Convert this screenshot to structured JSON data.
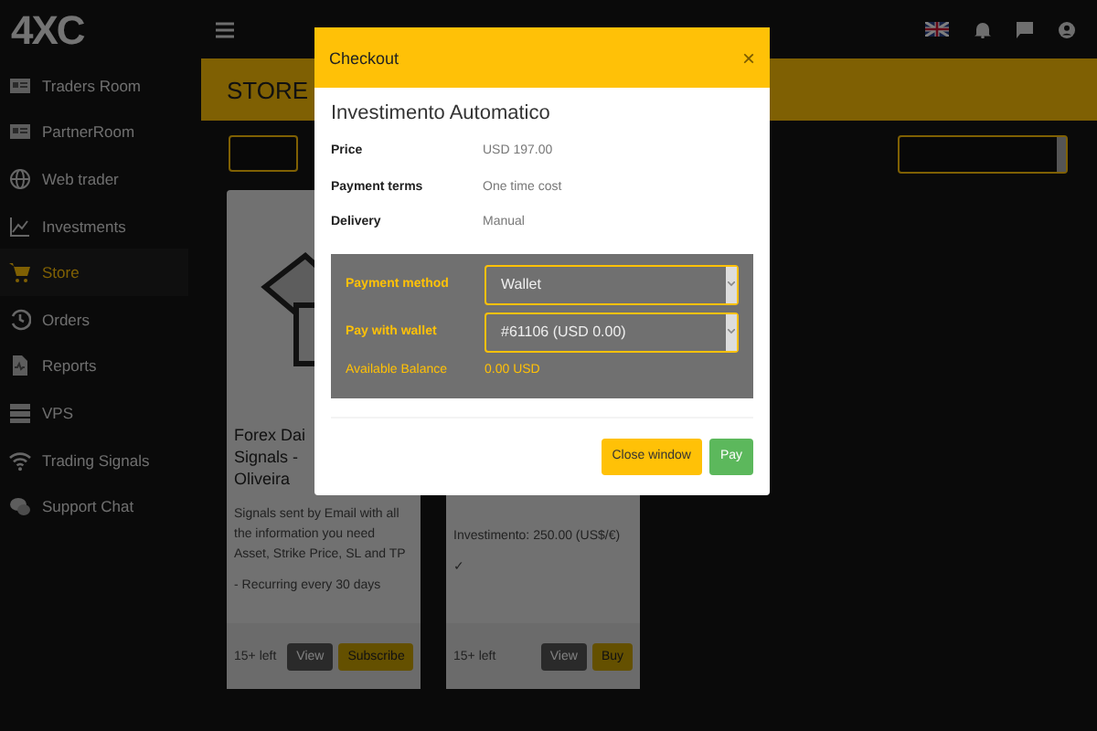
{
  "brand": "4XC",
  "sidebar": {
    "items": [
      {
        "label": "Traders Room",
        "selected": false
      },
      {
        "label": "PartnerRoom",
        "selected": false
      },
      {
        "label": "Web trader",
        "selected": false
      },
      {
        "label": "Investments",
        "selected": false
      },
      {
        "label": "Store",
        "selected": true
      },
      {
        "label": "Orders",
        "selected": false
      },
      {
        "label": "Reports",
        "selected": false
      },
      {
        "label": "VPS",
        "selected": false
      },
      {
        "label": "Trading Signals",
        "selected": false
      },
      {
        "label": "Support Chat",
        "selected": false
      }
    ]
  },
  "page": {
    "title": "STORE"
  },
  "cards": [
    {
      "kind": "image",
      "title_lines": [
        "Forex Dai",
        "Signals -",
        "Oliveira"
      ],
      "description": "Signals sent by Email with all the information you need Asset, Strike Price, SL and TP",
      "note": "- Recurring every 30 days",
      "stock": "15+ left",
      "buttons": [
        "View",
        "Subscribe"
      ]
    },
    {
      "kind": "covered",
      "description": "Investimento: 250.00 (US$/€)",
      "note": "✓",
      "stock": "15+ left",
      "buttons": [
        "View",
        "Buy"
      ]
    }
  ],
  "modal": {
    "title": "Checkout",
    "close": "×",
    "product": "Investimento Automatico",
    "details": [
      {
        "label": "Price",
        "value": "USD 197.00"
      },
      {
        "label": "Payment terms",
        "value": "One time cost"
      },
      {
        "label": "Delivery",
        "value": "Manual"
      }
    ],
    "payment_method": {
      "label": "Payment method",
      "value": "Wallet"
    },
    "wallet": {
      "label": "Pay with wallet",
      "value": "#61106 (USD 0.00)"
    },
    "balance": {
      "label": "Available Balance",
      "value": "0.00 USD"
    },
    "buttons": [
      {
        "kind": "secondary",
        "label": "Close window"
      },
      {
        "kind": "primary",
        "label": "Pay"
      }
    ]
  }
}
